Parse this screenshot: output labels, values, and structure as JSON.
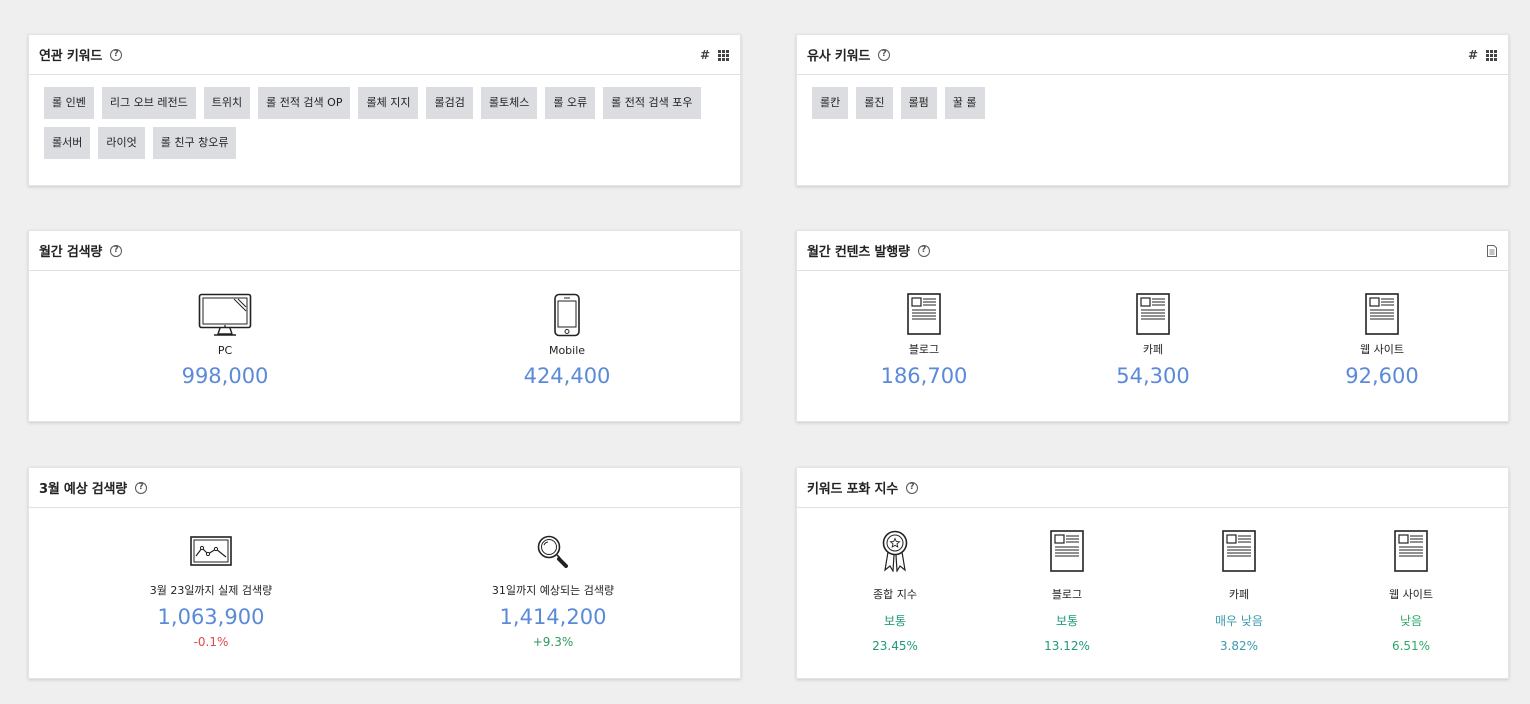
{
  "related": {
    "title": "연관 키워드",
    "help": "?",
    "hash": "#",
    "tags": [
      "롤 인벤",
      "리그 오브 레전드",
      "트위치",
      "롤 전적 검색 OP",
      "롤체 지지",
      "롤검검",
      "롤토체스",
      "롤 오류",
      "롤 전적 검색 포우",
      "롤서버",
      "라이엇",
      "롤 친구 창오류"
    ]
  },
  "similar": {
    "title": "유사 키워드",
    "help": "?",
    "hash": "#",
    "tags": [
      "롤칸",
      "롤진",
      "롤펌",
      "꿀 롤"
    ]
  },
  "monthly_search": {
    "title": "월간 검색량",
    "help": "?",
    "items": [
      {
        "label": "PC",
        "value": "998,000",
        "icon": "monitor-icon"
      },
      {
        "label": "Mobile",
        "value": "424,400",
        "icon": "mobile-phone-icon"
      }
    ]
  },
  "monthly_content": {
    "title": "월간 컨텐츠 발행량",
    "help": "?",
    "items": [
      {
        "label": "블로그",
        "value": "186,700",
        "icon": "document-icon"
      },
      {
        "label": "카페",
        "value": "54,300",
        "icon": "document-icon"
      },
      {
        "label": "웹 사이트",
        "value": "92,600",
        "icon": "document-icon"
      }
    ]
  },
  "forecast": {
    "title": "3월 예상 검색량",
    "help": "?",
    "items": [
      {
        "label": "3월 23일까지 실제 검색량",
        "value": "1,063,900",
        "change": "-0.1%",
        "icon": "line-chart-icon"
      },
      {
        "label": "31일까지 예상되는 검색량",
        "value": "1,414,200",
        "change": "+9.3%",
        "icon": "magnifier-icon"
      }
    ]
  },
  "saturation": {
    "title": "키워드 포화 지수",
    "help": "?",
    "items": [
      {
        "label": "종합 지수",
        "level": "보통",
        "pct": "23.45%",
        "icon": "award-ribbon-icon"
      },
      {
        "label": "블로그",
        "level": "보통",
        "pct": "13.12%",
        "icon": "document-icon"
      },
      {
        "label": "카페",
        "level": "매우 낮음",
        "pct": "3.82%",
        "icon": "document-icon"
      },
      {
        "label": "웹 사이트",
        "level": "낮음",
        "pct": "6.51%",
        "icon": "document-icon"
      }
    ]
  },
  "colors": {
    "value_blue": "#5a8ad8",
    "negative": "#e04a4a",
    "positive": "#2e9a5a",
    "level_teal": "#1e9a7a",
    "background": "#efefef"
  }
}
